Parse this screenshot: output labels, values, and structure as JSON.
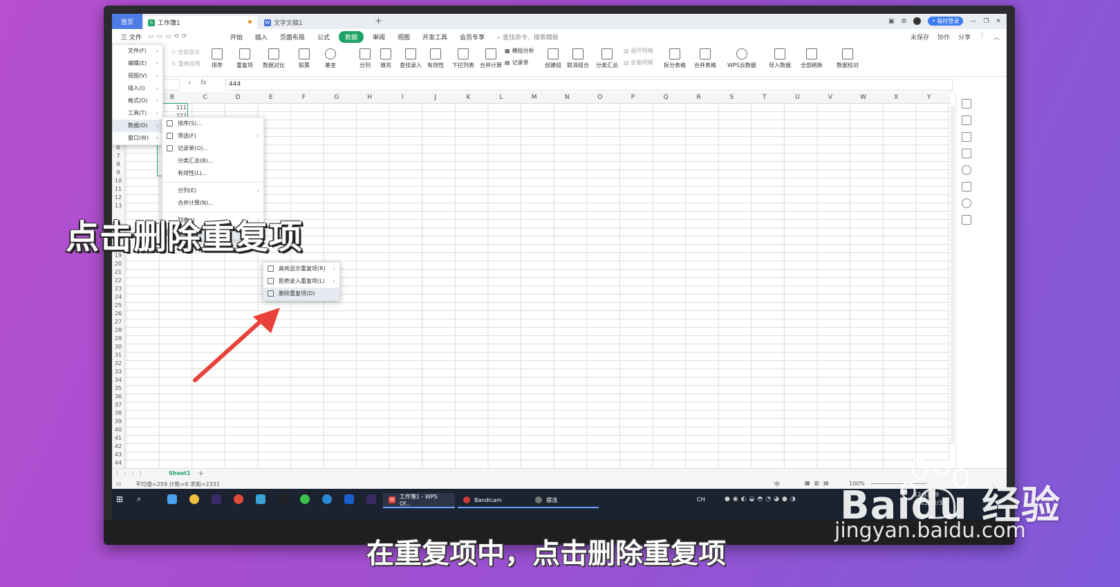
{
  "window": {
    "tabs": [
      {
        "label": "首页"
      },
      {
        "label": "工作簿1",
        "icon": "S"
      },
      {
        "label": "文字文稿1",
        "icon": "W"
      }
    ],
    "login": "• 临时登录"
  },
  "menubar": {
    "file": "三 文件",
    "tabs": [
      "开始",
      "插入",
      "页面布局",
      "公式",
      "数据",
      "审阅",
      "视图",
      "开发工具",
      "会员专享"
    ],
    "active_tab": "数据",
    "search": "查找命令、搜索模板",
    "right": [
      "未保存",
      "协作",
      "分享"
    ]
  },
  "ribbon": {
    "small_left": [
      "全部显示",
      "重新应用"
    ],
    "buttons": [
      "排序",
      "重复项",
      "数据对比",
      "股票",
      "基金",
      "分列",
      "填充",
      "查找录入",
      "有效性",
      "下拉列表",
      "合并计算",
      "创建组",
      "取消组合",
      "分类汇总",
      "拆分表格",
      "合并表格",
      "WPS云数据",
      "导入数据",
      "全部刷新",
      "数据校对"
    ],
    "small_mid": [
      "模拟分析",
      "记录单"
    ],
    "small_right": [
      "展开明细",
      "折叠明细"
    ]
  },
  "formula_bar": {
    "fx": "fx",
    "value": "444"
  },
  "grid": {
    "columns": [
      "B",
      "C",
      "D",
      "E",
      "F",
      "G",
      "H",
      "I",
      "J",
      "K",
      "L",
      "M",
      "N",
      "O",
      "P",
      "Q",
      "R",
      "S",
      "T",
      "U",
      "V",
      "W",
      "X",
      "Y"
    ],
    "rows": [
      "6",
      "7",
      "8",
      "9",
      "10",
      "11",
      "12",
      "13",
      "19",
      "20",
      "21",
      "22",
      "23",
      "24",
      "25",
      "26",
      "27",
      "28",
      "29",
      "30",
      "31",
      "32",
      "33",
      "34",
      "35",
      "36",
      "37",
      "38",
      "39",
      "40",
      "41",
      "42",
      "43",
      "44"
    ],
    "cell_values": [
      "111",
      "222"
    ]
  },
  "file_menu": {
    "items": [
      "文件(F)",
      "编辑(E)",
      "视图(V)",
      "插入(I)",
      "格式(O)",
      "工具(T)",
      "数据(D)",
      "窗口(W)"
    ]
  },
  "data_menu": {
    "items": [
      "排序(S)...",
      "筛选(F)",
      "记录单(O)...",
      "分类汇总(B)...",
      "有效性(L)...",
      "分列(E)",
      "合并计算(N)...",
      "列表(I)",
      "重复项(R)"
    ]
  },
  "dup_menu": {
    "items": [
      "高亮显示重复项(R)",
      "拒绝录入重复项(L)",
      "删除重复项(D)"
    ]
  },
  "sheetbar": {
    "sheet": "Sheet1",
    "add": "+"
  },
  "status": {
    "summary": "平均值=259  计数=9  求和=2331",
    "zoom": "100%",
    "lang": "中"
  },
  "taskbar": {
    "apps": [
      "工作簿1 - WPS Of...",
      "Bandicam",
      "摆浅"
    ],
    "tray_lang": "CH",
    "time": "12:33:39",
    "date": "2022/12/30"
  },
  "overlay": {
    "title": "点击删除重复项"
  },
  "caption": {
    "text": "在重复项中，点击删除重复项"
  },
  "watermark": {
    "logo": "Baidu 经验",
    "url": "jingyan.baidu.com"
  },
  "colors": {
    "accent_green": "#1fa365",
    "arrow_red": "#e8423a",
    "tab_blue": "#4e7ce6"
  }
}
